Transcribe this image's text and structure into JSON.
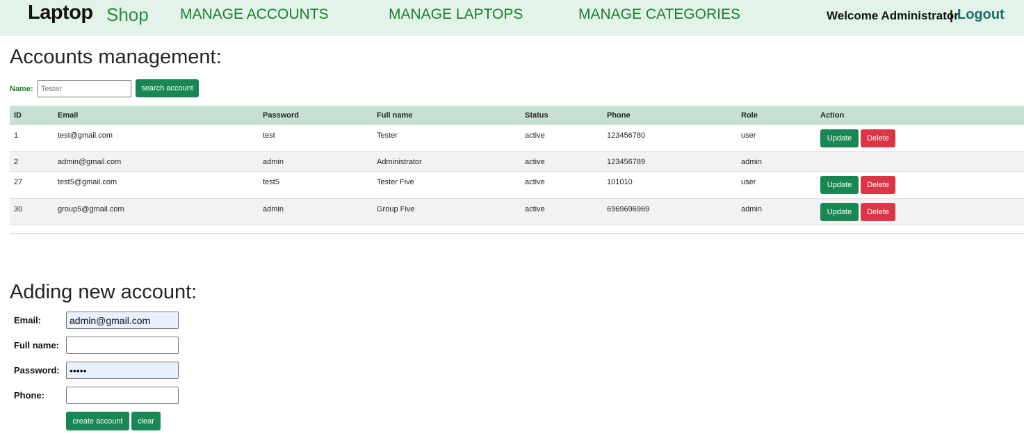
{
  "header": {
    "logo_primary": "Laptop",
    "logo_secondary": "Shop",
    "nav": [
      "MANAGE ACCOUNTS",
      "MANAGE LAPTOPS",
      "MANAGE CATEGORIES"
    ],
    "welcome": "Welcome Administrator",
    "separator": "|",
    "logout": "Logout"
  },
  "accounts": {
    "title": "Accounts management:",
    "search": {
      "label": "Name:",
      "value": "Tester",
      "button": "search account"
    },
    "columns": [
      "ID",
      "Email",
      "Password",
      "Full name",
      "Status",
      "Phone",
      "Role",
      "Action"
    ],
    "update_label": "Update",
    "delete_label": "Delete",
    "rows": [
      {
        "id": "1",
        "email": "test@gmail.com",
        "password": "test",
        "full_name": "Tester",
        "status": "active",
        "phone": "123456780",
        "role": "user"
      },
      {
        "id": "2",
        "email": "admin@gmail.com",
        "password": "admin",
        "full_name": "Administrator",
        "status": "active",
        "phone": "123456789",
        "role": "admin"
      },
      {
        "id": "27",
        "email": "test5@gmail.com",
        "password": "test5",
        "full_name": "Tester Five",
        "status": "active",
        "phone": "101010",
        "role": "user"
      },
      {
        "id": "30",
        "email": "group5@gmail.com",
        "password": "admin",
        "full_name": "Group Five",
        "status": "active",
        "phone": "6969696969",
        "role": "admin"
      }
    ]
  },
  "add_form": {
    "title": "Adding new account:",
    "email_label": "Email:",
    "email_value": "admin@gmail.com",
    "fullname_label": "Full name:",
    "fullname_value": "",
    "password_label": "Password:",
    "password_value": "admin",
    "phone_label": "Phone:",
    "phone_value": "",
    "create_button": "create account",
    "clear_button": "clear"
  },
  "colors": {
    "primary_green": "#198754",
    "danger_red": "#dc3545",
    "header_bg": "#e2f3ea",
    "nav_green": "#1e7d2c"
  }
}
